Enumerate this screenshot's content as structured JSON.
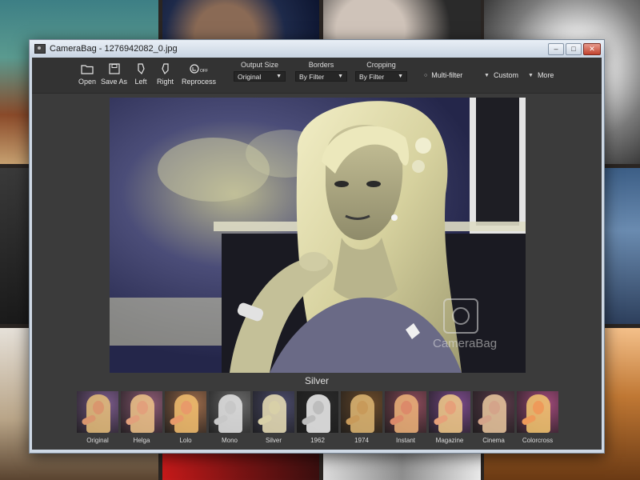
{
  "window": {
    "title": "CameraBag - 1276942082_0.jpg",
    "controls": {
      "minimize": "–",
      "maximize": "□",
      "close": "✕"
    }
  },
  "toolbar": {
    "tools": [
      {
        "label": "Open",
        "icon": "folder-icon"
      },
      {
        "label": "Save As",
        "icon": "save-icon"
      },
      {
        "label": "Left",
        "icon": "rotate-left-icon"
      },
      {
        "label": "Right",
        "icon": "rotate-right-icon"
      },
      {
        "label": "Reprocess",
        "icon": "reprocess-icon"
      }
    ],
    "groups": [
      {
        "label": "Output Size",
        "value": "Original"
      },
      {
        "label": "Borders",
        "value": "By Filter"
      },
      {
        "label": "Cropping",
        "value": "By Filter"
      }
    ],
    "options": [
      {
        "label": "Multi-filter",
        "bullet": "○"
      },
      {
        "label": "Custom",
        "bullet": "▼"
      },
      {
        "label": "More",
        "bullet": "▼"
      }
    ]
  },
  "preview": {
    "filter_name": "Silver",
    "watermark": "CameraBag"
  },
  "filters": [
    {
      "label": "Original",
      "tint": "#d9966e",
      "hair": "#e8c07a",
      "bg": "#7a5a8a"
    },
    {
      "label": "Helga",
      "tint": "#e2a07c",
      "hair": "#f0c48a",
      "bg": "#8c5a74"
    },
    {
      "label": "Lolo",
      "tint": "#e89a6a",
      "hair": "#f5c070",
      "bg": "#9a6a4a"
    },
    {
      "label": "Mono",
      "tint": "#c8c8c8",
      "hair": "#e6e6e6",
      "bg": "#6a6a6a"
    },
    {
      "label": "Silver",
      "tint": "#d8d0a8",
      "hair": "#ece2b8",
      "bg": "#4a4a6a"
    },
    {
      "label": "1962",
      "tint": "#bdbdbd",
      "hair": "#f2f2f2",
      "bg": "#2a2a2a"
    },
    {
      "label": "1974",
      "tint": "#c89a5a",
      "hair": "#e0b874",
      "bg": "#6a4a2a"
    },
    {
      "label": "Instant",
      "tint": "#dc8a6a",
      "hair": "#f0b47a",
      "bg": "#8a4a5a"
    },
    {
      "label": "Magazine",
      "tint": "#e6a07a",
      "hair": "#f4cc8a",
      "bg": "#7a4a8a"
    },
    {
      "label": "Cinema",
      "tint": "#d4a48a",
      "hair": "#ecc9a0",
      "bg": "#5a3a4a"
    },
    {
      "label": "Colorcross",
      "tint": "#ee9a5a",
      "hair": "#f6c870",
      "bg": "#a04a7a"
    }
  ]
}
